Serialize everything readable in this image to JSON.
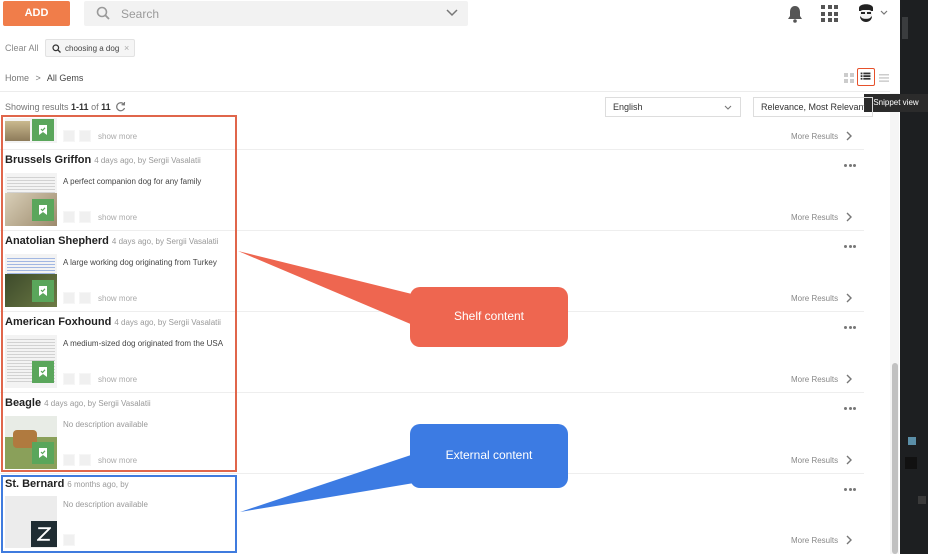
{
  "toolbar": {
    "add_label": "ADD",
    "search_placeholder": "Search"
  },
  "filters": {
    "clear_all": "Clear All",
    "chip_label": "choosing a dog",
    "chip_close": "×"
  },
  "breadcrumb": {
    "home": "Home",
    "separator": ">",
    "current": "All Gems"
  },
  "view": {
    "tooltip": "Snippet view"
  },
  "results_summary": {
    "prefix": "Showing results ",
    "range": "1-11",
    "of": " of ",
    "total": "11"
  },
  "language_select": {
    "value": "English"
  },
  "sort_select": {
    "value": "Relevance, Most Relevant"
  },
  "labels": {
    "show_more": "show more",
    "more_results": "More Results"
  },
  "results": [
    {
      "title": "Brussels Griffon",
      "meta": "4 days ago, by Sergii Vasalatii",
      "description": "A perfect companion dog for any family"
    },
    {
      "title": "Anatolian Shepherd",
      "meta": "4 days ago, by Sergii Vasalatii",
      "description": "A large working dog originating from Turkey"
    },
    {
      "title": "American Foxhound",
      "meta": "4 days ago, by Sergii Vasalatii",
      "description": "A medium-sized dog originated from the USA"
    },
    {
      "title": "Beagle",
      "meta": "4 days ago, by Sergii Vasalatii",
      "description": "No description available"
    },
    {
      "title": "St. Bernard",
      "meta": "6 months ago, by",
      "description": "No description available"
    }
  ],
  "annotations": {
    "shelf": "Shelf content",
    "external": "External content",
    "shelf_color": "#ee6650",
    "external_color": "#3c7be3"
  },
  "colors": {
    "accent": "#f07d4a",
    "badge_green": "#5aa65b"
  }
}
